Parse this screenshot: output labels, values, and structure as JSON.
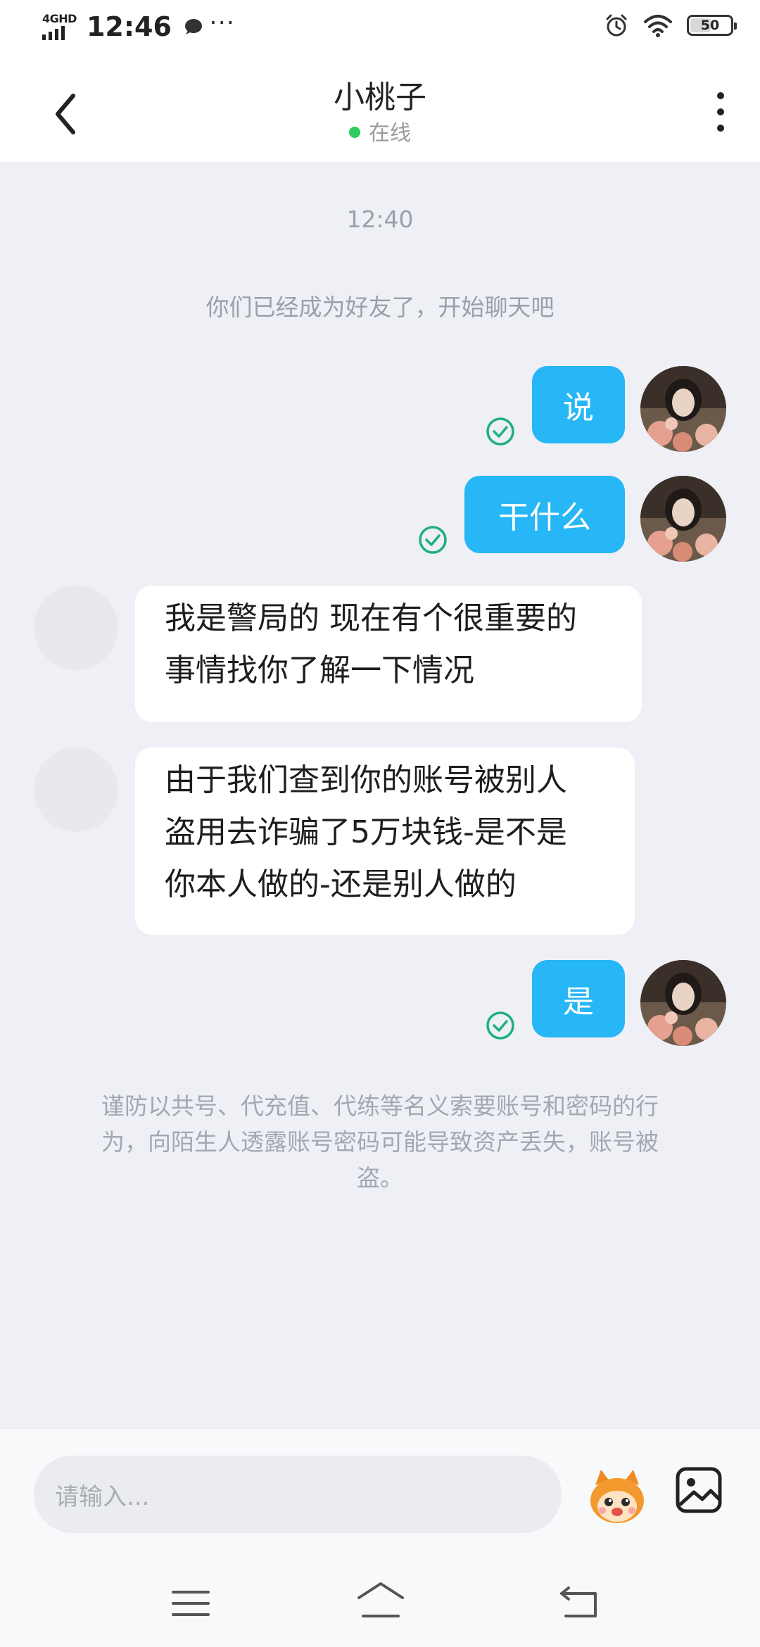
{
  "status_bar": {
    "network": "4GHD",
    "time": "12:46",
    "more": "···",
    "battery": "50"
  },
  "header": {
    "title": "小桃子",
    "status": "在线"
  },
  "chat": {
    "timestamp": "12:40",
    "system_message": "你们已经成为好友了，开始聊天吧",
    "messages": [
      {
        "sender": "me",
        "text": "说",
        "status": "delivered"
      },
      {
        "sender": "me",
        "text": "干什么",
        "status": "delivered"
      },
      {
        "sender": "other",
        "line1": "我是警局的 现在有个很重要的",
        "line2": "事情找你了解一下情况"
      },
      {
        "sender": "other",
        "line1": "由于我们查到你的账号被别人",
        "line2": "盗用去诈骗了5万块钱-是不是",
        "line3": "你本人做的-还是别人做的"
      },
      {
        "sender": "me",
        "text": "是",
        "status": "delivered"
      }
    ],
    "warning_line1": "谨防以共号、代充值、代练等名义索要账号和密码的行",
    "warning_line2": "为，向陌生人透露账号密码可能导致资产丢失，账号被",
    "warning_line3": "盗。"
  },
  "input": {
    "placeholder": "请输入..."
  },
  "icons": {
    "back": "chevron-left-icon",
    "menu": "more-vertical-icon",
    "check": "check-circle-icon",
    "emoji": "emoji-sticker-icon",
    "image": "image-icon"
  },
  "colors": {
    "accent": "#27b6f6",
    "online": "#2ecc5e",
    "check": "#1fb07a",
    "background": "#eef0f6"
  }
}
